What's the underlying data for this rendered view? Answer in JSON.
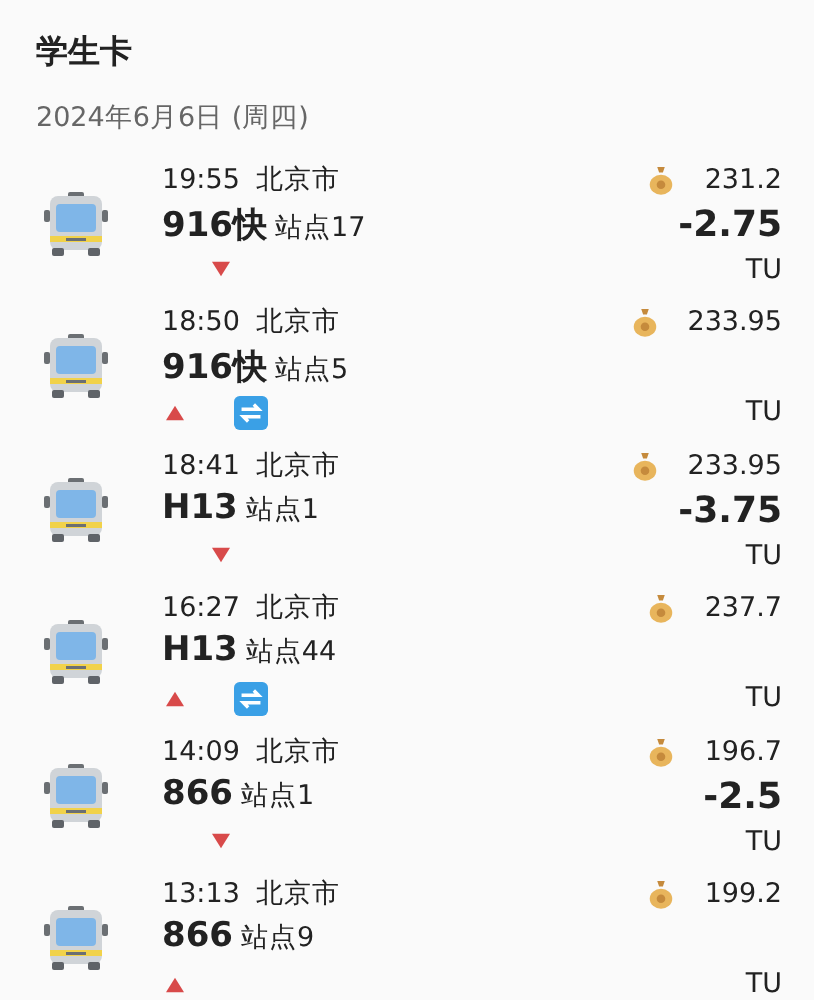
{
  "title": "学生卡",
  "date": "2024年6月6日 (周四)",
  "trips": [
    {
      "time": "19:55",
      "city": "北京市",
      "route": "916快",
      "stop": "站点17",
      "kind": "alighting",
      "transfer": false,
      "balance": "231.2",
      "amount": "-2.75",
      "unit": "TU"
    },
    {
      "time": "18:50",
      "city": "北京市",
      "route": "916快",
      "stop": "站点5",
      "kind": "boarding",
      "transfer": true,
      "balance": "233.95",
      "unit": "TU"
    },
    {
      "time": "18:41",
      "city": "北京市",
      "route": "H13",
      "stop": "站点1",
      "kind": "alighting",
      "transfer": false,
      "balance": "233.95",
      "amount": "-3.75",
      "unit": "TU"
    },
    {
      "time": "16:27",
      "city": "北京市",
      "route": "H13",
      "stop": "站点44",
      "kind": "boarding",
      "transfer": true,
      "balance": "237.7",
      "unit": "TU"
    },
    {
      "time": "14:09",
      "city": "北京市",
      "route": "866",
      "stop": "站点1",
      "kind": "alighting",
      "transfer": false,
      "balance": "196.7",
      "amount": "-2.5",
      "unit": "TU"
    },
    {
      "time": "13:13",
      "city": "北京市",
      "route": "866",
      "stop": "站点9",
      "kind": "boarding",
      "transfer": false,
      "balance": "199.2",
      "unit": "TU"
    }
  ]
}
